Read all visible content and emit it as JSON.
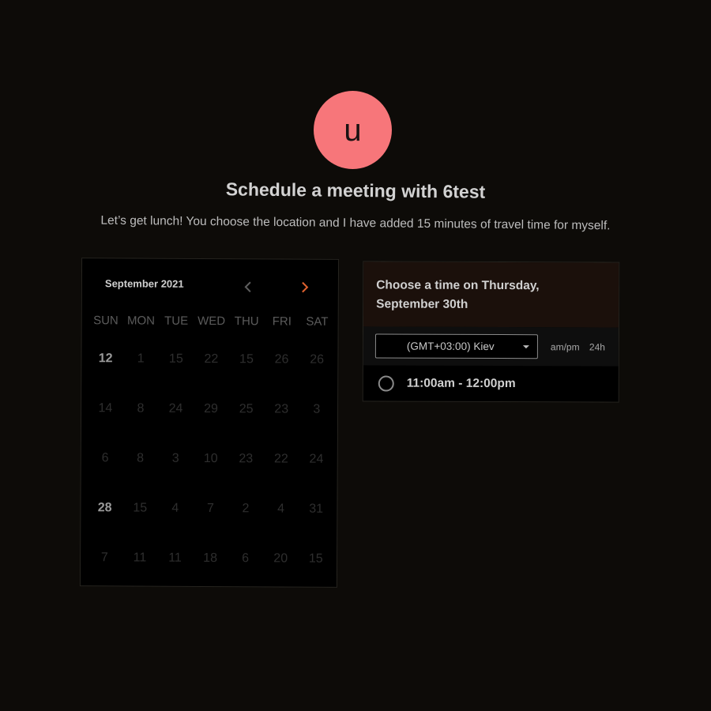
{
  "header": {
    "avatar_letter": "u",
    "title": "Schedule a meeting with 6test",
    "description": "Let’s get lunch! You choose the location and I have added 15 minutes of travel time for myself."
  },
  "calendar": {
    "month_label": "September 2021",
    "weekdays": [
      "SUN",
      "MON",
      "TUE",
      "WED",
      "THU",
      "FRI",
      "SAT"
    ],
    "days": [
      [
        "12",
        "1",
        "15",
        "22",
        "15",
        "26",
        "26"
      ],
      [
        "14",
        "8",
        "24",
        "29",
        "25",
        "23",
        "3"
      ],
      [
        "6",
        "8",
        "3",
        "10",
        "23",
        "22",
        "24"
      ],
      [
        "28",
        "15",
        "4",
        "7",
        "2",
        "4",
        "31"
      ],
      [
        "7",
        "11",
        "11",
        "18",
        "6",
        "20",
        "15"
      ]
    ],
    "active_days": [
      "12",
      "28"
    ],
    "prev_color": "#5e5e5e",
    "next_color": "#e0622f"
  },
  "time_panel": {
    "heading": "Choose a time on Thursday, September 30th",
    "timezone": "(GMT+03:00) Kiev",
    "format_ampm": "am/pm",
    "format_24h": "24h",
    "slots": [
      {
        "label": "11:00am - 12:00pm"
      }
    ]
  },
  "colors": {
    "background": "#0d0b08",
    "avatar": "#f7767a",
    "panel_header": "#1b100b"
  }
}
